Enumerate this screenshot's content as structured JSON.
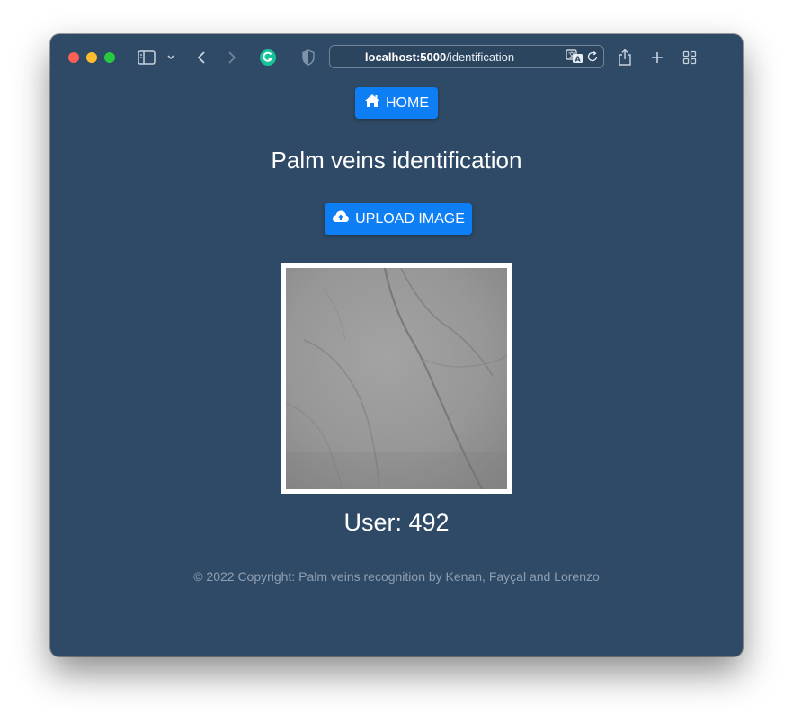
{
  "browser": {
    "url_host": "localhost:5000",
    "url_path": "/identification",
    "icons": {
      "sidebar": "sidebar-icon",
      "chevron": "chevron-down-icon",
      "back": "back-arrow-icon",
      "forward": "forward-arrow-icon",
      "extension": "grammarly-icon",
      "privacy": "shield-icon",
      "translate": "translate-icon",
      "reload": "reload-icon",
      "share": "share-icon",
      "new_tab": "plus-icon",
      "tabs": "tab-overview-icon"
    }
  },
  "page": {
    "home_label": "HOME",
    "title": "Palm veins identification",
    "upload_label": "UPLOAD IMAGE",
    "user_result": "User: 492",
    "footer": "© 2022 Copyright: Palm veins recognition by Kenan, Fayçal and Lorenzo"
  },
  "colors": {
    "page_background": "#2f4a66",
    "button": "#0d7ef4",
    "footer_text": "#8f9fb2"
  }
}
